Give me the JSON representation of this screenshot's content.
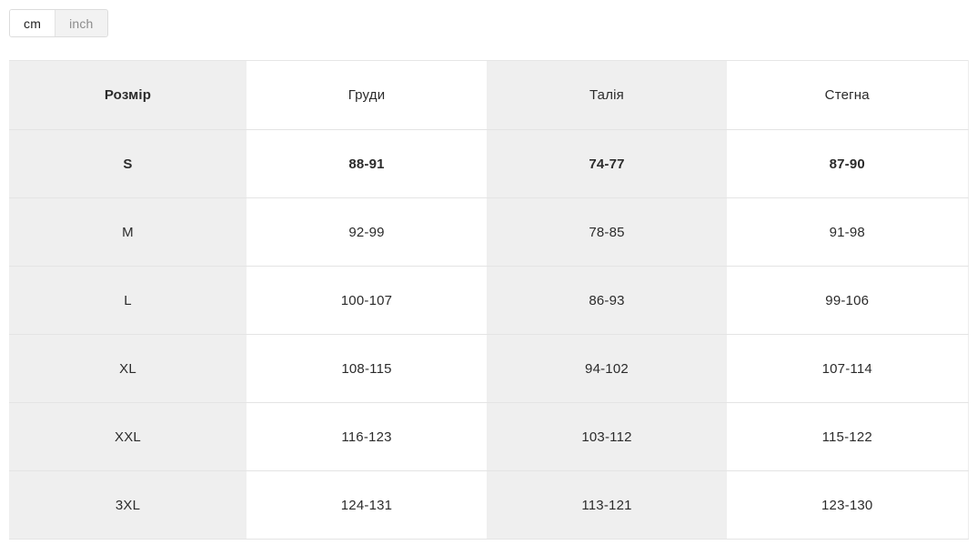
{
  "unit_toggle": {
    "options": [
      {
        "label": "cm",
        "active": true
      },
      {
        "label": "inch",
        "active": false
      }
    ]
  },
  "size_table": {
    "headers": [
      {
        "label": "Розмір",
        "bold": true,
        "shaded": true
      },
      {
        "label": "Груди",
        "bold": false,
        "shaded": false
      },
      {
        "label": "Талія",
        "bold": false,
        "shaded": true
      },
      {
        "label": "Стегна",
        "bold": false,
        "shaded": false
      }
    ],
    "rows": [
      {
        "highlight": true,
        "cells": [
          "S",
          "88-91",
          "74-77",
          "87-90"
        ]
      },
      {
        "highlight": false,
        "cells": [
          "M",
          "92-99",
          "78-85",
          "91-98"
        ]
      },
      {
        "highlight": false,
        "cells": [
          "L",
          "100-107",
          "86-93",
          "99-106"
        ]
      },
      {
        "highlight": false,
        "cells": [
          "XL",
          "108-115",
          "94-102",
          "107-114"
        ]
      },
      {
        "highlight": false,
        "cells": [
          "XXL",
          "116-123",
          "103-112",
          "115-122"
        ]
      },
      {
        "highlight": false,
        "cells": [
          "3XL",
          "124-131",
          "113-121",
          "123-130"
        ]
      }
    ]
  },
  "colors": {
    "shaded_cell": "#efefef",
    "cell_background": "#ffffff",
    "row_border": "#e4e4e4",
    "text": "#2b2b2b",
    "toggle_active_bg": "#ffffff",
    "toggle_inactive_bg": "#f2f2f2",
    "toggle_inactive_text": "#8c8c8c",
    "toggle_border": "#dcdcdc"
  }
}
